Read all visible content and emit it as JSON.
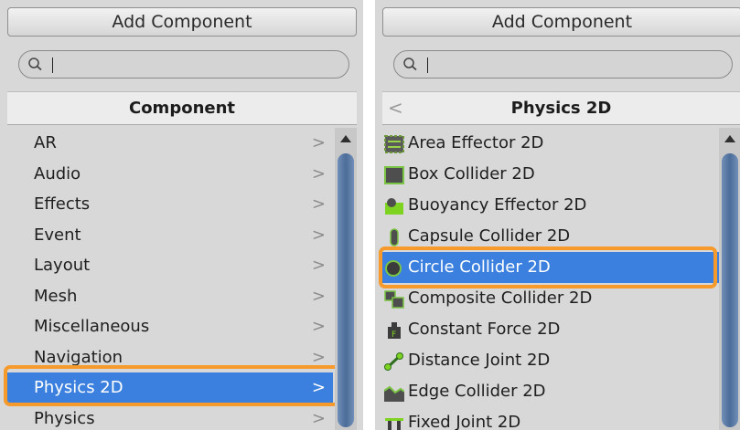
{
  "colors": {
    "selection": "#3b80de",
    "highlight": "#f59a2b"
  },
  "left": {
    "add_button": "Add Component",
    "search": {
      "value": ""
    },
    "header": "Component",
    "items": [
      {
        "label": "AR",
        "chevron": ">"
      },
      {
        "label": "Audio",
        "chevron": ">"
      },
      {
        "label": "Effects",
        "chevron": ">"
      },
      {
        "label": "Event",
        "chevron": ">"
      },
      {
        "label": "Layout",
        "chevron": ">"
      },
      {
        "label": "Mesh",
        "chevron": ">"
      },
      {
        "label": "Miscellaneous",
        "chevron": ">"
      },
      {
        "label": "Navigation",
        "chevron": ">"
      },
      {
        "label": "Physics 2D",
        "chevron": ">",
        "selected": true
      },
      {
        "label": "Physics",
        "chevron": ">"
      }
    ]
  },
  "right": {
    "add_button": "Add Component",
    "search": {
      "value": ""
    },
    "header": "Physics 2D",
    "back_glyph": "<",
    "items": [
      {
        "label": "Area Effector 2D",
        "icon": "area-effector-icon"
      },
      {
        "label": "Box Collider 2D",
        "icon": "box-collider-icon"
      },
      {
        "label": "Buoyancy Effector 2D",
        "icon": "buoyancy-effector-icon"
      },
      {
        "label": "Capsule Collider 2D",
        "icon": "capsule-collider-icon"
      },
      {
        "label": "Circle Collider 2D",
        "icon": "circle-collider-icon",
        "selected": true
      },
      {
        "label": "Composite Collider 2D",
        "icon": "composite-collider-icon"
      },
      {
        "label": "Constant Force 2D",
        "icon": "constant-force-icon"
      },
      {
        "label": "Distance Joint 2D",
        "icon": "distance-joint-icon"
      },
      {
        "label": "Edge Collider 2D",
        "icon": "edge-collider-icon"
      },
      {
        "label": "Fixed Joint 2D",
        "icon": "fixed-joint-icon"
      }
    ]
  }
}
